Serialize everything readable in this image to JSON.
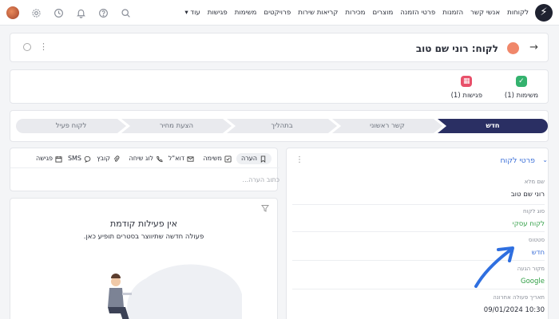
{
  "nav": {
    "logo_glyph": "⚡",
    "items": [
      "לקוחות",
      "אנשי קשר",
      "הזמנות",
      "פרטי הזמנה",
      "מוצרים",
      "מכירות",
      "קריאות שירות",
      "פרויקטים",
      "משימות",
      "פגישות"
    ],
    "more_label": "עוד",
    "icons": [
      "avatar",
      "gear-icon",
      "clock-icon",
      "bell-icon",
      "help-icon",
      "search-icon"
    ]
  },
  "header": {
    "title": "לקוח: רוני שם טוב",
    "back_glyph": "→",
    "dots_glyph": "⋮"
  },
  "summary": {
    "tasks": {
      "label": "משימות (1)",
      "color": "#34b26e"
    },
    "meetings": {
      "label": "פגישות (1)",
      "color": "#e8506a"
    }
  },
  "pipeline": {
    "stages": [
      "חדש",
      "קשר ראשוני",
      "בתהליך",
      "הצעת מחיר",
      "לקוח פעיל"
    ],
    "active_index": 0,
    "active_color": "#2a2f63"
  },
  "details": {
    "title": "פרטי לקוח",
    "chevron_glyph": "⌄",
    "dots_glyph": "⋮",
    "fields": [
      {
        "label": "שם מלא",
        "value": "רוני שם טוב",
        "color": "#2b2f3a"
      },
      {
        "label": "סוג לקוח",
        "value": "לקוח עסקי",
        "color": "#2f9e44"
      },
      {
        "label": "סטטוס",
        "value": "חדש",
        "color": "#3b6fd8"
      },
      {
        "label": "מקור הגעה",
        "value": "Google",
        "color": "#2f9e44"
      },
      {
        "label": "תאריך פעולה אחרונה",
        "value": "09/01/2024 10:30",
        "color": "#2b2f3a"
      }
    ]
  },
  "activity": {
    "toolbar": [
      "הערה",
      "משימה",
      "דוא\"ל",
      "לוג שיחה",
      "קובץ",
      "SMS",
      "פגישה"
    ],
    "note_placeholder": "כתוב הערה...",
    "empty_title": "אין פעילות קודמת",
    "empty_subtitle": "פעולה חדשה שתיווצר בסטרים תופיע כאן."
  },
  "annotation_color": "#2f6fe0"
}
